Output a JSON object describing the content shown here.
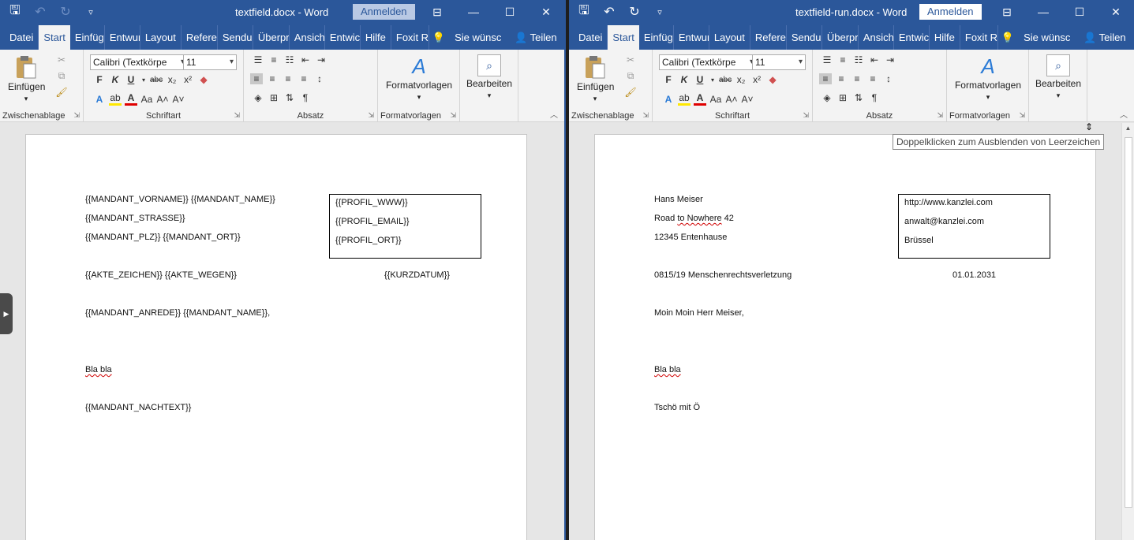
{
  "left": {
    "title": "textfield.docx  -  Word",
    "signin": "Anmelden",
    "tabs": [
      "Datei",
      "Start",
      "Einfüg",
      "Entwur",
      "Layout",
      "Referer",
      "Sendur",
      "Überpr",
      "Ansich",
      "Entwicl",
      "Hilfe",
      "Foxit R"
    ],
    "search": "Sie wünsc",
    "share": "Teilen",
    "font": "Calibri (Textkörpe",
    "size": "11",
    "groups": [
      "Zwischenablage",
      "Schriftart",
      "Absatz",
      "Formatvorlagen"
    ],
    "paste": "Einfügen",
    "styles": "Formatvorlagen",
    "edit": "Bearbeiten",
    "doc": {
      "line1": "{{MANDANT_VORNAME}} {{MANDANT_NAME}}",
      "line2": "{{MANDANT_STRASSE}}",
      "line3": "{{MANDANT_PLZ}} {{MANDANT_ORT}}",
      "box1": "{{PROFIL_WWW}}",
      "box2": "{{PROFIL_EMAIL}}",
      "box3": "{{PROFIL_ORT}}",
      "ref": "{{AKTE_ZEICHEN}} {{AKTE_WEGEN}}",
      "date": "{{KURZDATUM}}",
      "salutation": "{{MANDANT_ANREDE}} {{MANDANT_NAME}},",
      "body": "Bla bla",
      "closing": "{{MANDANT_NACHTEXT}}"
    }
  },
  "right": {
    "title": "textfield-run.docx  -  Word",
    "signin": "Anmelden",
    "tabs": [
      "Datei",
      "Start",
      "Einfüg",
      "Entwur",
      "Layout",
      "Referer",
      "Sendur",
      "Überpr",
      "Ansich",
      "Entwic",
      "Hilfe",
      "Foxit R"
    ],
    "search": "Sie wünsc",
    "share": "Teilen",
    "font": "Calibri (Textkörpe",
    "size": "11",
    "groups": [
      "Zwischenablage",
      "Schriftart",
      "Absatz",
      "Formatvorlagen"
    ],
    "paste": "Einfügen",
    "styles": "Formatvorlagen",
    "edit": "Bearbeiten",
    "tooltip": "Doppelklicken zum Ausblenden von Leerzeichen",
    "doc": {
      "line1": "Hans Meiser",
      "line2_pre": "Road ",
      "line2_spell": "to Nowhere",
      "line2_post": " 42",
      "line3": "12345 Entenhause",
      "box1": "http://www.kanzlei.com",
      "box2": "anwalt@kanzlei.com",
      "box3": "Brüssel",
      "ref": "0815/19 Menschenrechtsverletzung",
      "date": "01.01.2031",
      "salutation": "Moin Moin Herr Meiser,",
      "body": "Bla bla",
      "closing": "Tschö mit Ö"
    }
  }
}
